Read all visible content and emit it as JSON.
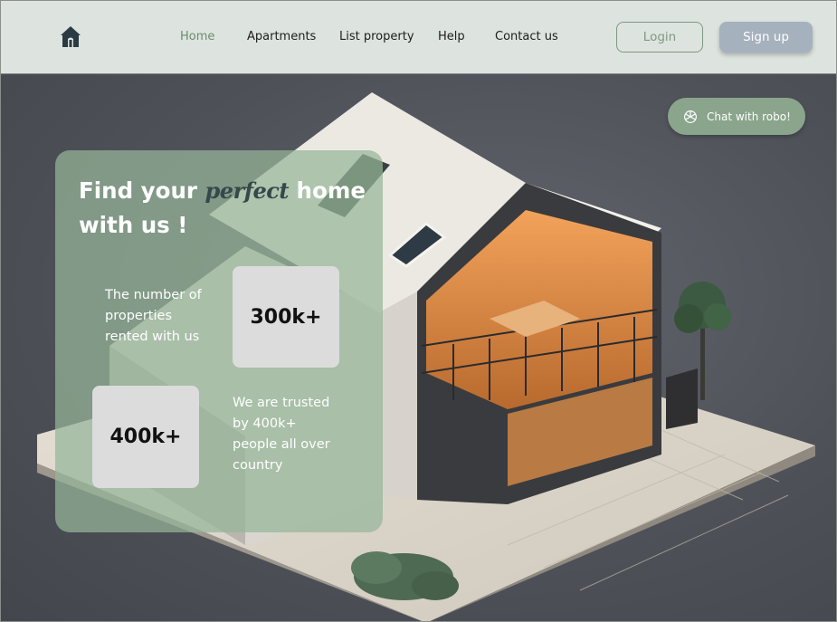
{
  "colors": {
    "nav_bg": "#dde3de",
    "accent_green": "#8aa58c",
    "signup_bg": "#a6b1be",
    "card_bg": "rgba(150,182,152,0.72)"
  },
  "nav": {
    "logo_icon": "house-icon",
    "links": [
      {
        "label": "Home",
        "active": true
      },
      {
        "label": "Apartments",
        "active": false
      },
      {
        "label": "List  property",
        "active": false
      },
      {
        "label": "Help",
        "active": false
      },
      {
        "label": "Contact us",
        "active": false
      }
    ],
    "login_label": "Login",
    "signup_label": "Sign up"
  },
  "hero": {
    "chat_icon": "openai-knot-icon",
    "chat_label": "Chat with robo!",
    "headline_before": "Find your",
    "headline_accent": "perfect",
    "headline_after": " home",
    "headline_line2": "with us !",
    "stats": [
      {
        "value": "300k+",
        "text_lines": [
          "The number of",
          "properties",
          "rented with us"
        ]
      },
      {
        "value": "400k+",
        "text_lines": [
          "We are trusted",
          "by 400k+",
          "people all over",
          "country"
        ]
      }
    ]
  }
}
